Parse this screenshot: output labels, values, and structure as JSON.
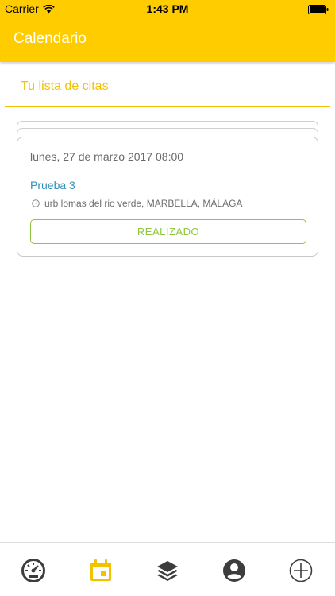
{
  "status_bar": {
    "carrier": "Carrier",
    "time": "1:43 PM"
  },
  "header": {
    "title": "Calendario"
  },
  "section": {
    "title": "Tu lista de citas"
  },
  "appointment": {
    "date": "lunes, 27 de marzo 2017 08:00",
    "name": "Prueba 3",
    "address": "urb lomas del rio verde, MARBELLA, MÁLAGA",
    "status_button": "REALIZADO"
  },
  "tabs": [
    {
      "icon": "speedometer-icon",
      "active": false
    },
    {
      "icon": "calendar-icon",
      "active": true
    },
    {
      "icon": "layers-icon",
      "active": false
    },
    {
      "icon": "user-icon",
      "active": false
    },
    {
      "icon": "add-icon",
      "active": false
    }
  ],
  "colors": {
    "brand": "#FFCC00",
    "accent_text": "#F2C200",
    "link": "#2E8FB8",
    "success": "#8DC63F",
    "icon_inactive": "#3d3d3d"
  }
}
